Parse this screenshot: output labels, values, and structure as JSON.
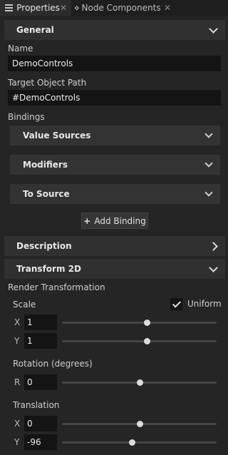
{
  "tabs": [
    {
      "label": "Properties",
      "close": "✕"
    },
    {
      "label": "Node Components",
      "close": "✕"
    }
  ],
  "general": {
    "title": "General",
    "name_label": "Name",
    "name_value": "DemoControls",
    "path_label": "Target Object Path",
    "path_value": "#DemoControls",
    "bindings_label": "Bindings",
    "binding_groups": [
      "Value Sources",
      "Modifiers",
      "To Source"
    ],
    "add_binding": "Add Binding"
  },
  "description": {
    "title": "Description"
  },
  "transform": {
    "title": "Transform 2D",
    "render_label": "Render Transformation",
    "scale_label": "Scale",
    "uniform_label": "Uniform",
    "uniform_checked": true,
    "scale_x": {
      "axis": "X",
      "value": "1",
      "slider_fraction": 0.55
    },
    "scale_y": {
      "axis": "Y",
      "value": "1",
      "slider_fraction": 0.55
    },
    "rotation_label": "Rotation (degrees)",
    "rotation": {
      "axis": "R",
      "value": "0",
      "slider_fraction": 0.5
    },
    "translation_label": "Translation",
    "translation_x": {
      "axis": "X",
      "value": "0",
      "slider_fraction": 0.5
    },
    "translation_y": {
      "axis": "Y",
      "value": "-96",
      "slider_fraction": 0.45
    }
  },
  "icons": {
    "properties_tab": "list-icon",
    "nodes_tab": "node-components-icon",
    "plus": "plus-icon"
  },
  "colors": {
    "panel": "#252525",
    "header": "#303030",
    "field": "#141414",
    "text": "#d8d8d8"
  }
}
